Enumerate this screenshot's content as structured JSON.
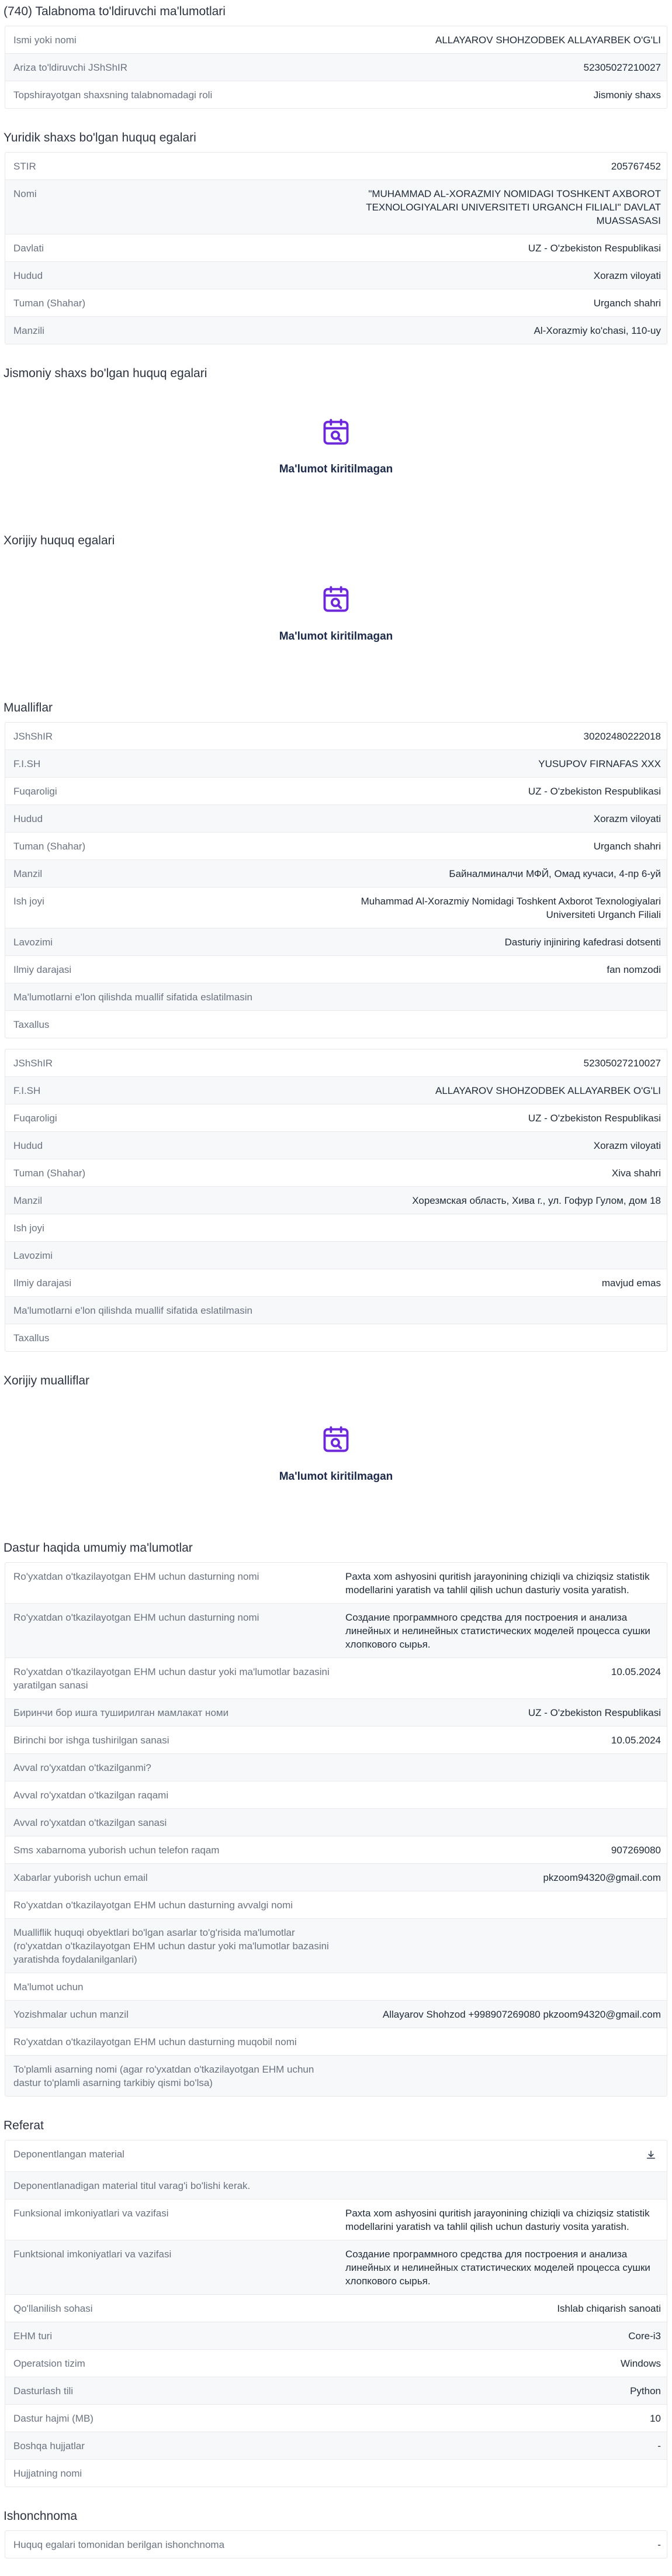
{
  "application": {
    "title": "(740) Talabnoma to'ldiruvchi ma'lumotlari",
    "rows": [
      {
        "label": "Ismi yoki nomi",
        "value": "ALLAYAROV SHOHZODBEK ALLAYARBEK O'G'LI"
      },
      {
        "label": "Ariza to'ldiruvchi JShShIR",
        "value": "52305027210027"
      },
      {
        "label": "Topshirayotgan shaxsning talabnomadagi roli",
        "value": "Jismoniy shaxs"
      }
    ]
  },
  "legal_owners": {
    "title": "Yuridik shaxs bo'lgan huquq egalari",
    "rows": [
      {
        "label": "STIR",
        "value": "205767452"
      },
      {
        "label": "Nomi",
        "value": "\"MUHAMMAD AL-XORAZMIY NOMIDAGI TOSHKENT AXBOROT TEXNOLOGIYALARI UNIVERSITETI URGANCH FILIALI\" DAVLAT MUASSASASI"
      },
      {
        "label": "Davlati",
        "value": "UZ - O'zbekiston Respublikasi"
      },
      {
        "label": "Hudud",
        "value": "Xorazm viloyati"
      },
      {
        "label": "Tuman (Shahar)",
        "value": "Urganch shahri"
      },
      {
        "label": "Manzili",
        "value": "Al-Xorazmiy ko'chasi, 110-uy"
      }
    ]
  },
  "individual_owners": {
    "title": "Jismoniy shaxs bo'lgan huquq egalari",
    "empty_text": "Ma'lumot kiritilmagan"
  },
  "foreign_owners": {
    "title": "Xorijiy huquq egalari",
    "empty_text": "Ma'lumot kiritilmagan"
  },
  "authors": {
    "title": "Mualliflar",
    "items": [
      {
        "rows": [
          {
            "label": "JShShIR",
            "value": "30202480222018"
          },
          {
            "label": "F.I.SH",
            "value": "YUSUPOV FIRNAFAS XXX"
          },
          {
            "label": "Fuqaroligi",
            "value": "UZ - O'zbekiston Respublikasi"
          },
          {
            "label": "Hudud",
            "value": "Xorazm viloyati"
          },
          {
            "label": "Tuman (Shahar)",
            "value": "Urganch shahri"
          },
          {
            "label": "Manzil",
            "value": "Байналминалчи МФЙ, Омад кучаси, 4-пр 6-уй"
          },
          {
            "label": "Ish joyi",
            "value": "Muhammad Al-Xorazmiy Nomidagi Toshkent Axborot Texnologiyalari Universiteti Urganch Filiali"
          },
          {
            "label": "Lavozimi",
            "value": "Dasturiy injiniring kafedrasi dotsenti"
          },
          {
            "label": "Ilmiy darajasi",
            "value": "fan nomzodi"
          },
          {
            "label": "Ma'lumotlarni e'lon qilishda muallif sifatida eslatilmasin",
            "value": ""
          },
          {
            "label": "Taxallus",
            "value": ""
          }
        ]
      },
      {
        "rows": [
          {
            "label": "JShShIR",
            "value": "52305027210027"
          },
          {
            "label": "F.I.SH",
            "value": "ALLAYAROV SHOHZODBEK ALLAYARBEK O'G'LI"
          },
          {
            "label": "Fuqaroligi",
            "value": "UZ - O'zbekiston Respublikasi"
          },
          {
            "label": "Hudud",
            "value": "Xorazm viloyati"
          },
          {
            "label": "Tuman (Shahar)",
            "value": "Xiva shahri"
          },
          {
            "label": "Manzil",
            "value": "Хорезмская область, Хива г., ул. Гофур Гулом, дом 18"
          },
          {
            "label": "Ish joyi",
            "value": ""
          },
          {
            "label": "Lavozimi",
            "value": ""
          },
          {
            "label": "Ilmiy darajasi",
            "value": "mavjud emas"
          },
          {
            "label": "Ma'lumotlarni e'lon qilishda muallif sifatida eslatilmasin",
            "value": ""
          },
          {
            "label": "Taxallus",
            "value": ""
          }
        ]
      }
    ]
  },
  "foreign_authors": {
    "title": "Xorijiy mualliflar",
    "empty_text": "Ma'lumot kiritilmagan"
  },
  "program_info": {
    "title": "Dastur haqida umumiy ma'lumotlar",
    "rows": [
      {
        "label": "Ro'yxatdan o'tkazilayotgan EHM uchun dasturning nomi",
        "value": "Paxta xom ashyosini quritish jarayonining chiziqli va chiziqsiz statistik modellarini yaratish va tahlil qilish uchun dasturiy vosita yaratish.",
        "block": true
      },
      {
        "label": "Ro'yxatdan o'tkazilayotgan EHM uchun dasturning nomi",
        "value": "Создание программного средства для построения и анализа линейных и нелинейных статистических моделей процесса сушки хлопкового сырья.",
        "block": true
      },
      {
        "label": "Ro'yxatdan o'tkazilayotgan EHM uchun dastur yoki ma'lumotlar bazasini yaratilgan sanasi",
        "value": "10.05.2024"
      },
      {
        "label": "Биринчи бор ишга туширилган мамлакат номи",
        "value": "UZ - O'zbekiston Respublikasi"
      },
      {
        "label": "Birinchi bor ishga tushirilgan sanasi",
        "value": "10.05.2024"
      },
      {
        "label": "Avval ro'yxatdan o'tkazilganmi?",
        "value": ""
      },
      {
        "label": "Avval ro'yxatdan o'tkazilgan raqami",
        "value": ""
      },
      {
        "label": "Avval ro'yxatdan o'tkazilgan sanasi",
        "value": ""
      },
      {
        "label": "Sms xabarnoma yuborish uchun telefon raqam",
        "value": "907269080"
      },
      {
        "label": "Xabarlar yuborish uchun email",
        "value": "pkzoom94320@gmail.com"
      },
      {
        "label": "Ro'yxatdan o'tkazilayotgan EHM uchun dasturning avvalgi nomi",
        "value": ""
      },
      {
        "label": "Mualliflik huquqi obyektlari bo'lgan asarlar to'g'risida ma'lumotlar (ro'yxatdan o'tkazilayotgan EHM uchun dastur yoki ma'lumotlar bazasini yaratishda foydalanilganlari)",
        "value": ""
      },
      {
        "label": "Ma'lumot uchun",
        "value": ""
      },
      {
        "label": "Yozishmalar uchun manzil",
        "value": "Allayarov Shohzod +998907269080 pkzoom94320@gmail.com"
      },
      {
        "label": "Ro'yxatdan o'tkazilayotgan EHM uchun dasturning muqobil nomi",
        "value": ""
      },
      {
        "label": "To'plamli asarning nomi (agar ro'yxatdan o'tkazilayotgan EHM uchun dastur to'plamli asarning tarkibiy qismi bo'lsa)",
        "value": ""
      }
    ]
  },
  "referat": {
    "title": "Referat",
    "deposit_label": "Deponentlangan material",
    "rows": [
      {
        "label": "Deponentlanadigan material titul varag'i bo'lishi kerak.",
        "value": ""
      },
      {
        "label": "Funksional imkoniyatlari va vazifasi",
        "value": "Paxta xom ashyosini quritish jarayonining chiziqli va chiziqsiz statistik modellarini yaratish va tahlil qilish uchun dasturiy vosita yaratish.",
        "block": true
      },
      {
        "label": "Funktsional imkoniyatlari va vazifasi",
        "value": "Создание программного средства для построения и анализа линейных и нелинейных статистических моделей процесса сушки хлопкового сырья.",
        "block": true
      },
      {
        "label": "Qo'llanilish sohasi",
        "value": "Ishlab chiqarish sanoati"
      },
      {
        "label": "EHM turi",
        "value": "Core-i3"
      },
      {
        "label": "Operatsion tizim",
        "value": "Windows"
      },
      {
        "label": "Dasturlash tili",
        "value": "Python"
      },
      {
        "label": "Dastur hajmi (MB)",
        "value": "10"
      },
      {
        "label": "Boshqa hujjatlar",
        "value": "-"
      },
      {
        "label": "Hujjatning nomi",
        "value": ""
      }
    ]
  },
  "power_of_attorney": {
    "title": "Ishonchnoma",
    "rows": [
      {
        "label": "Huquq egalari tomonidan berilgan ishonchnoma",
        "value": "-"
      }
    ]
  },
  "icons": {
    "empty_state": "calendar-search-icon",
    "download": "download-icon"
  },
  "colors": {
    "accent": "#6d28d9",
    "row_alt": "#f7f8fa",
    "label": "#6b7280"
  }
}
